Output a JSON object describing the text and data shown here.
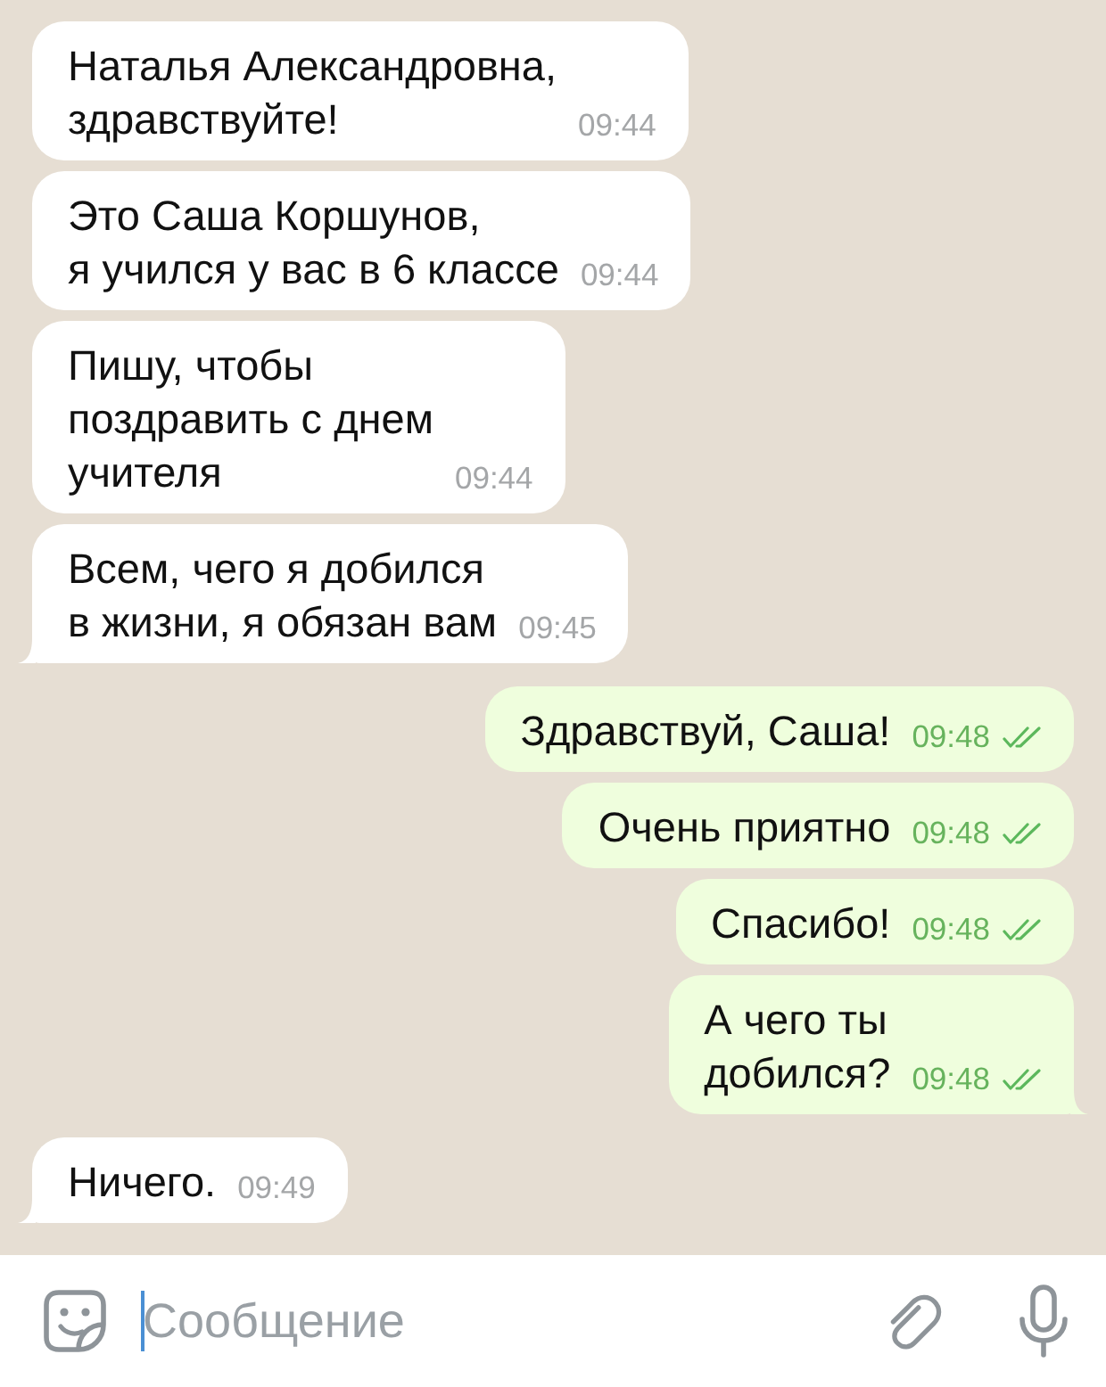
{
  "messages": [
    {
      "kind": "incoming",
      "text": "Наталья Александровна,\nздравствуйте!",
      "time": "09:44"
    },
    {
      "kind": "incoming",
      "text": "Это Саша Коршунов,\nя учился у вас в 6 классе",
      "time": "09:44"
    },
    {
      "kind": "incoming",
      "text": "Пишу, чтобы\nпоздравить с днем\nучителя",
      "time": "09:44"
    },
    {
      "kind": "incoming",
      "text": "Всем, чего я добился\nв жизни, я обязан вам",
      "time": "09:45"
    },
    {
      "kind": "outgoing",
      "text": "Здравствуй, Саша!",
      "time": "09:48",
      "read": true
    },
    {
      "kind": "outgoing",
      "text": "Очень приятно",
      "time": "09:48",
      "read": true
    },
    {
      "kind": "outgoing",
      "text": "Спасибо!",
      "time": "09:48",
      "read": true
    },
    {
      "kind": "outgoing",
      "text": "А чего ты\nдобился?",
      "time": "09:48",
      "read": true
    },
    {
      "kind": "incoming",
      "text": "Ничего.",
      "time": "09:49"
    }
  ],
  "composer": {
    "placeholder": "Сообщение",
    "focused": true
  }
}
